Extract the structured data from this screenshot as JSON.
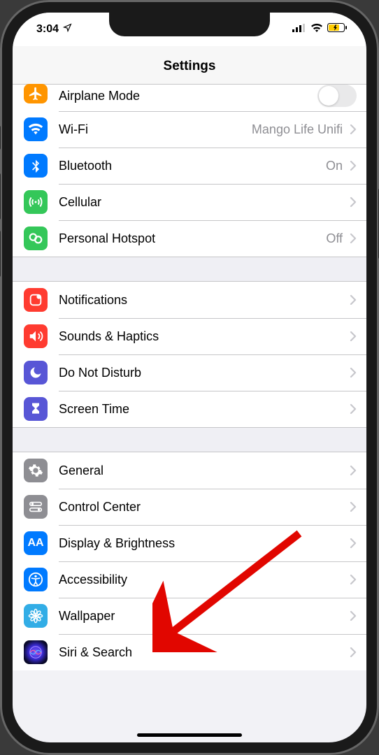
{
  "statusbar": {
    "time": "3:04"
  },
  "header": {
    "title": "Settings"
  },
  "groups": [
    {
      "name": "connectivity",
      "rows": [
        {
          "key": "airplane",
          "label": "Airplane Mode",
          "color": "ic-orange",
          "icon": "airplane-icon",
          "type": "switch",
          "on": false,
          "chevron": false,
          "truncated": true
        },
        {
          "key": "wifi",
          "label": "Wi-Fi",
          "color": "ic-blue",
          "icon": "wifi-icon",
          "value": "Mango Life Unifi",
          "chevron": true
        },
        {
          "key": "bluetooth",
          "label": "Bluetooth",
          "color": "ic-blue",
          "icon": "bluetooth-icon",
          "value": "On",
          "chevron": true
        },
        {
          "key": "cellular",
          "label": "Cellular",
          "color": "ic-green",
          "icon": "cellular-icon",
          "chevron": true
        },
        {
          "key": "hotspot",
          "label": "Personal Hotspot",
          "color": "ic-green",
          "icon": "hotspot-icon",
          "value": "Off",
          "chevron": true
        }
      ]
    },
    {
      "name": "notifications",
      "rows": [
        {
          "key": "notifications",
          "label": "Notifications",
          "color": "ic-red",
          "icon": "notifications-icon",
          "chevron": true
        },
        {
          "key": "sounds",
          "label": "Sounds & Haptics",
          "color": "ic-red",
          "icon": "sounds-icon",
          "chevron": true
        },
        {
          "key": "dnd",
          "label": "Do Not Disturb",
          "color": "ic-indigo",
          "icon": "moon-icon",
          "chevron": true
        },
        {
          "key": "screentime",
          "label": "Screen Time",
          "color": "ic-indigo",
          "icon": "hourglass-icon",
          "chevron": true
        }
      ]
    },
    {
      "name": "general-settings",
      "rows": [
        {
          "key": "general",
          "label": "General",
          "color": "ic-gray",
          "icon": "gear-icon",
          "chevron": true
        },
        {
          "key": "controlcenter",
          "label": "Control Center",
          "color": "ic-gray",
          "icon": "switches-icon",
          "chevron": true
        },
        {
          "key": "display",
          "label": "Display & Brightness",
          "color": "ic-blue",
          "icon": "aa-icon",
          "chevron": true
        },
        {
          "key": "accessibility",
          "label": "Accessibility",
          "color": "ic-blue",
          "icon": "accessibility-icon",
          "chevron": true
        },
        {
          "key": "wallpaper",
          "label": "Wallpaper",
          "color": "ic-cyan",
          "icon": "flower-icon",
          "chevron": true
        },
        {
          "key": "siri",
          "label": "Siri & Search",
          "color": "ic-siri",
          "icon": "siri-icon",
          "chevron": true
        }
      ]
    }
  ],
  "arrow_target": "accessibility"
}
